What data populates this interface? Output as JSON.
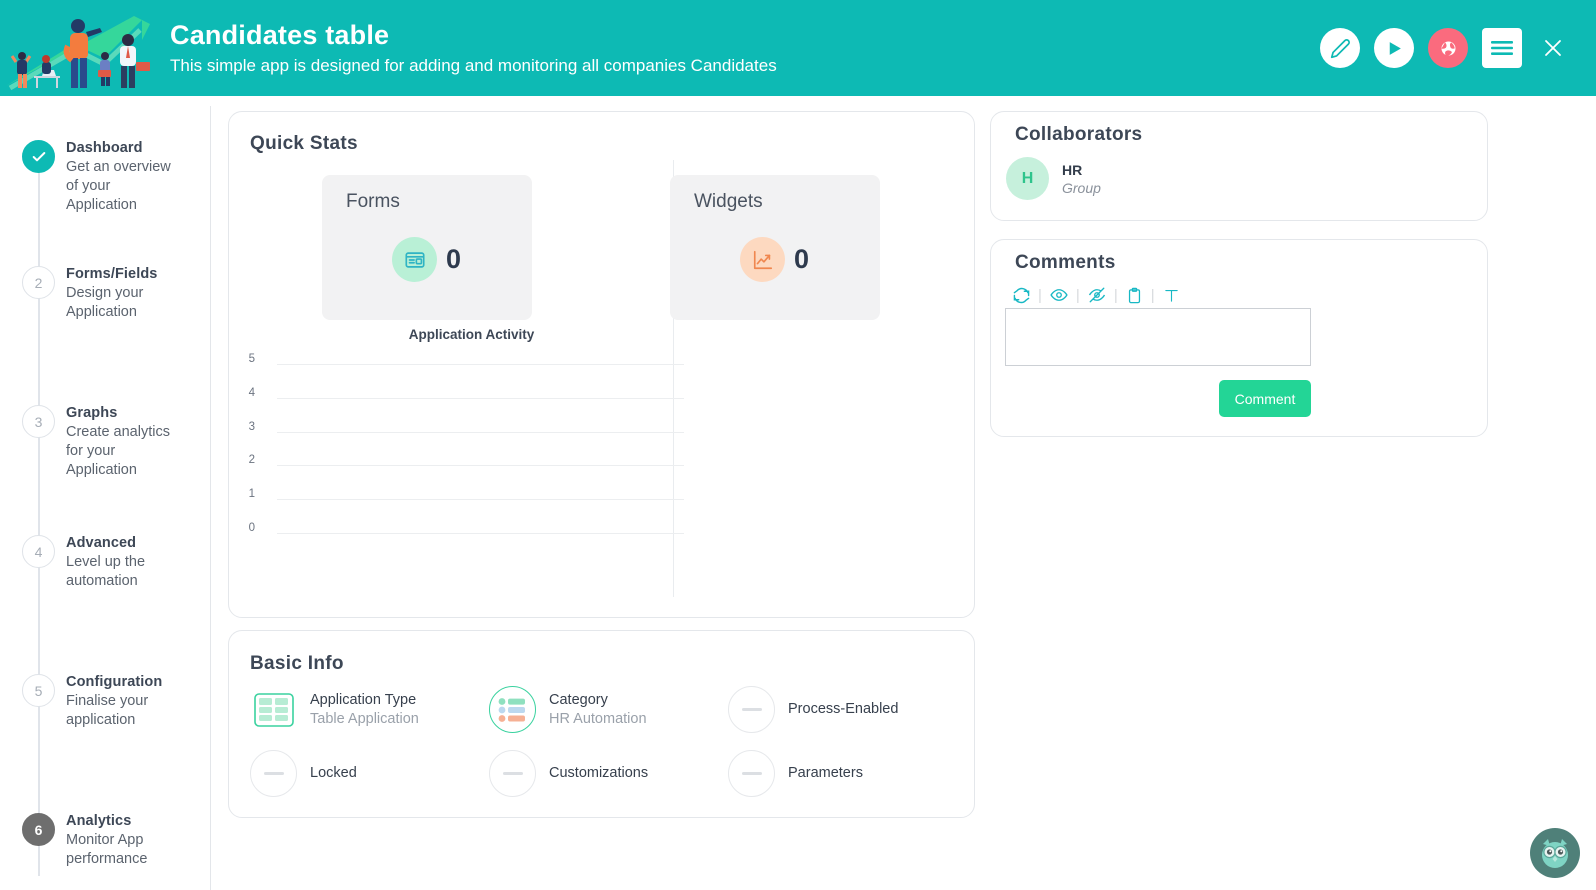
{
  "header": {
    "title": "Candidates table",
    "subtitle": "This simple app is designed for adding and monitoring all companies Candidates",
    "bg_color": "#0dbab4",
    "actions": [
      {
        "name": "edit-icon",
        "glyph": "pencil"
      },
      {
        "name": "run-icon",
        "glyph": "play"
      },
      {
        "name": "publish-icon",
        "glyph": "globe",
        "bg": "#fa6b7e"
      },
      {
        "name": "menu-icon",
        "glyph": "hamburger"
      },
      {
        "name": "close-icon",
        "glyph": "times"
      }
    ]
  },
  "sidebar": {
    "steps": [
      {
        "badge": "✓",
        "state": "done",
        "title": "Dashboard",
        "desc": "Get an overview of your Application"
      },
      {
        "badge": "2",
        "state": "todo",
        "title": "Forms/Fields",
        "desc": "Design your Application"
      },
      {
        "badge": "3",
        "state": "todo",
        "title": "Graphs",
        "desc": "Create analytics for your Application"
      },
      {
        "badge": "4",
        "state": "todo",
        "title": "Advanced",
        "desc": "Level up the automation"
      },
      {
        "badge": "5",
        "state": "todo",
        "title": "Configuration",
        "desc": "Finalise your application"
      },
      {
        "badge": "6",
        "state": "current",
        "title": "Analytics",
        "desc": "Monitor App performance"
      }
    ]
  },
  "quick_stats": {
    "title": "Quick Stats",
    "cards": [
      {
        "label": "Forms",
        "value": "0",
        "icon": "forms-icon",
        "circle_color": "#b9f0d6",
        "icon_color": "#2fb4c4"
      },
      {
        "label": "Widgets",
        "value": "0",
        "icon": "chart-line-icon",
        "circle_color": "#fdd9c0",
        "icon_color": "#f0874f"
      }
    ]
  },
  "chart_data": {
    "type": "line",
    "title": "Application Activity",
    "xlabel": "",
    "ylabel": "",
    "categories": [],
    "values": [],
    "series": [],
    "yticks": [
      "5",
      "4",
      "3",
      "2",
      "1",
      "0"
    ],
    "ylim": [
      0,
      5
    ],
    "grid": true,
    "legend": "none",
    "note": "empty plot — no data series rendered"
  },
  "basic_info": {
    "title": "Basic Info",
    "items": [
      {
        "label": "Application Type",
        "value": "Table Application",
        "icon": "table-icon",
        "state": "filled"
      },
      {
        "label": "Category",
        "value": "HR Automation",
        "icon": "category-list-icon",
        "state": "ring"
      },
      {
        "label": "Process-Enabled",
        "value": "",
        "icon": "dash-icon",
        "state": "empty"
      },
      {
        "label": "Locked",
        "value": "",
        "icon": "dash-icon",
        "state": "empty"
      },
      {
        "label": "Customizations",
        "value": "",
        "icon": "dash-icon",
        "state": "empty"
      },
      {
        "label": "Parameters",
        "value": "",
        "icon": "dash-icon",
        "state": "empty"
      }
    ]
  },
  "collaborators": {
    "title": "Collaborators",
    "list": [
      {
        "initial": "H",
        "name": "HR",
        "role": "Group"
      }
    ]
  },
  "comments": {
    "title": "Comments",
    "toolbar": [
      {
        "name": "refresh-icon"
      },
      {
        "name": "eye-icon"
      },
      {
        "name": "eye-off-icon"
      },
      {
        "name": "clipboard-icon"
      },
      {
        "name": "text-format-icon"
      }
    ],
    "separator": "|",
    "input_value": "",
    "input_placeholder": "",
    "button_label": "Comment",
    "button_color": "#23d596"
  },
  "help_widget": {
    "name": "owl-assistant-icon"
  }
}
